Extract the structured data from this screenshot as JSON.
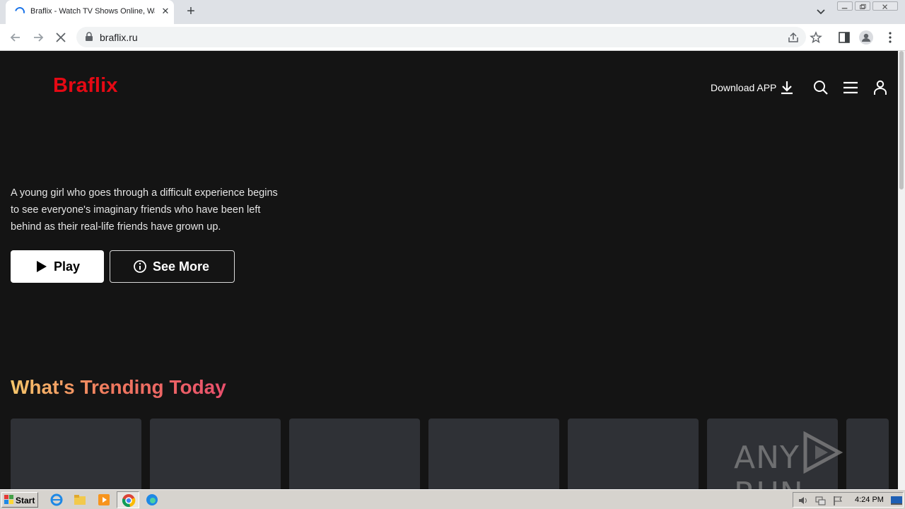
{
  "browser": {
    "tab_title": "Braflix - Watch TV Shows Online, Watch Movies Online",
    "url": "braflix.ru",
    "new_tab_label": "+",
    "close_tab_label": "✕"
  },
  "site": {
    "logo": "Braflix",
    "download_label": "Download APP",
    "hero_description": "A young girl who goes through a difficult experience begins to see everyone's imaginary friends who have been left behind as their real-life friends have grown up.",
    "play_label": "Play",
    "see_more_label": "See More",
    "section_title": "What's Trending Today",
    "accent_color": "#e50914",
    "card_count": 7
  },
  "watermark": {
    "text_left": "ANY",
    "text_right": "RUN"
  },
  "taskbar": {
    "start_label": "Start",
    "clock": "4:24 PM"
  }
}
